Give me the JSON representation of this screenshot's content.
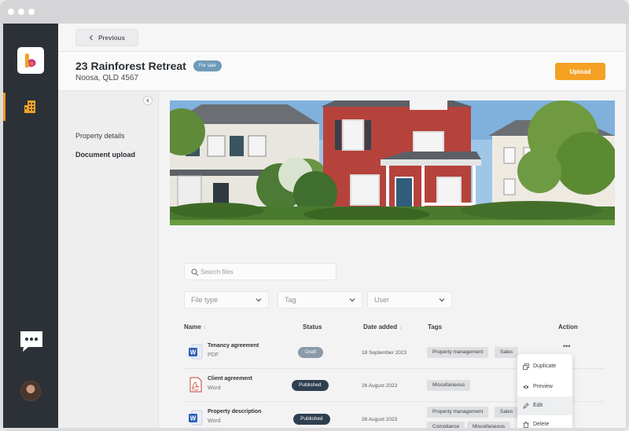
{
  "header": {
    "back_label": "Previous",
    "title": "23 Rainforest Retreat",
    "badge": "For sale",
    "address": "Noosa, QLD 4567",
    "upload_label": "Upload"
  },
  "leftnav": {
    "items": [
      {
        "label": "Property details",
        "active": false
      },
      {
        "label": "Document upload",
        "active": true
      }
    ]
  },
  "search": {
    "placeholder": "Search files"
  },
  "filters": [
    "File type",
    "Tag",
    "User"
  ],
  "table": {
    "columns": [
      "Name",
      "Status",
      "Date added",
      "Tags",
      "Action"
    ],
    "rows": [
      {
        "name": "Tenancy agreement",
        "type": "PDF",
        "icon": "word-icon",
        "status": "Draft",
        "date": "18 September 2023",
        "tags": [
          "Property management",
          "Sales"
        ]
      },
      {
        "name": "Client agreement",
        "type": "Word",
        "icon": "pdf-icon",
        "status": "Published",
        "date": "26 August 2023",
        "tags": [
          "Miscellaneous"
        ]
      },
      {
        "name": "Property description",
        "type": "Word",
        "icon": "word-icon",
        "status": "Published",
        "date": "26 August 2023",
        "tags": [
          "Property management",
          "Sales",
          "Compliance",
          "Miscellaneous"
        ]
      }
    ]
  },
  "action_menu": {
    "items": [
      "Duplicate",
      "Preview",
      "Edit",
      "Delete"
    ],
    "hover_item": "Edit"
  },
  "colors": {
    "accent": "#f4a124",
    "rail": "#2b3137",
    "badge": "#6f9ab8",
    "published": "#2f3f50",
    "draft": "#8a9aa9"
  }
}
